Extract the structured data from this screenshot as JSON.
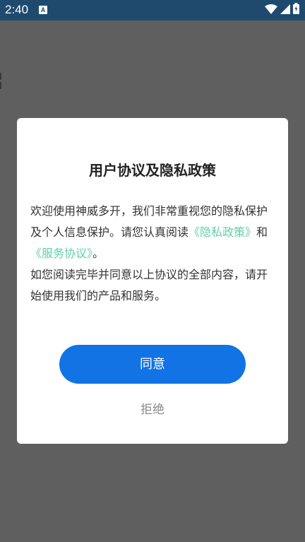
{
  "status_bar": {
    "time": "2:40",
    "app_icon": "A",
    "icons": [
      "wifi-icon",
      "signal-icon",
      "battery-icon"
    ],
    "background": "#1f4a6e"
  },
  "dialog": {
    "title": "用户协议及隐私政策",
    "intro_line_1": "欢迎使用神威多开，我们非常重视您的隐私保护及个人信息保护。请您认真阅读",
    "privacy_link": "《隐私政策》",
    "and_text": "和",
    "service_link": "《服务协议》",
    "period": "。",
    "paragraph_2": "如您阅读完毕并同意以上协议的全部内容，请开始使用我们的产品和服务。",
    "agree_label": "同意",
    "reject_label": "拒绝",
    "accent_color": "#1173e4",
    "link_color": "#5fcfa8"
  }
}
